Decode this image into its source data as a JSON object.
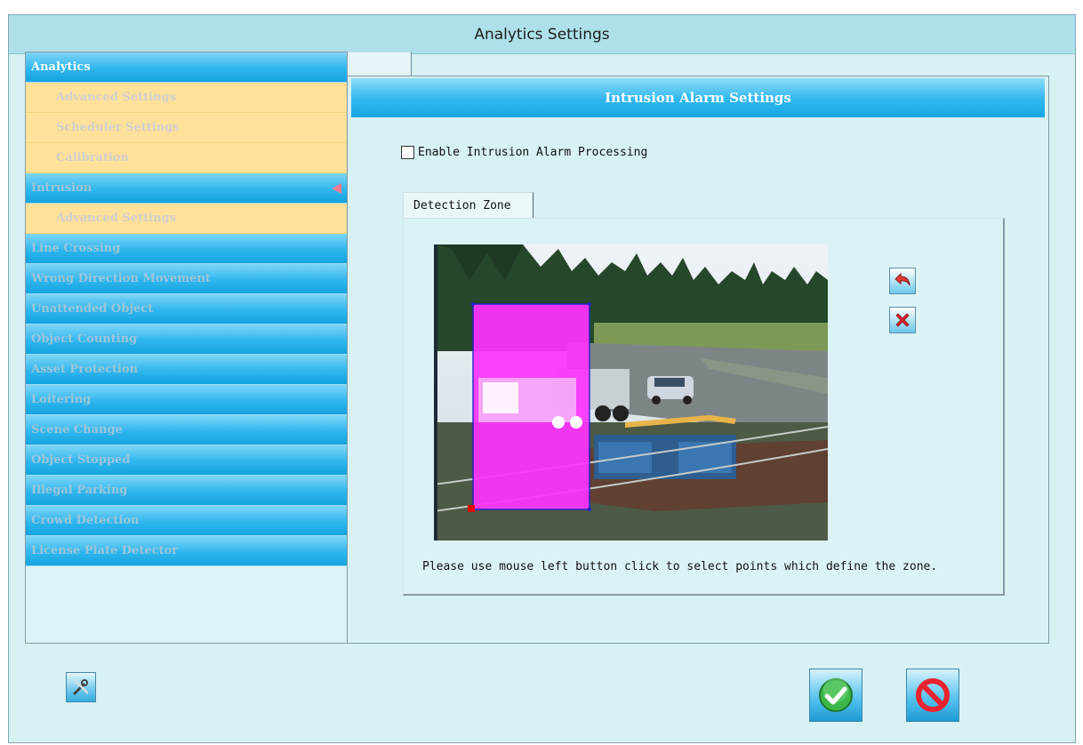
{
  "window": {
    "title": "Analytics Settings"
  },
  "sidebar": {
    "items": [
      {
        "label": "Analytics",
        "kind": "cat",
        "active": true
      },
      {
        "label": "Advanced Settings",
        "kind": "sub"
      },
      {
        "label": "Scheduler Settings",
        "kind": "sub"
      },
      {
        "label": "Calibration",
        "kind": "sub"
      },
      {
        "label": "Intrusion",
        "kind": "cat",
        "selected": true
      },
      {
        "label": "Advanced Settings",
        "kind": "sub"
      },
      {
        "label": "Line Crossing",
        "kind": "cat"
      },
      {
        "label": "Wrong Direction Movement",
        "kind": "cat"
      },
      {
        "label": "Unattended Object",
        "kind": "cat"
      },
      {
        "label": "Object Counting",
        "kind": "cat"
      },
      {
        "label": "Asset Protection",
        "kind": "cat"
      },
      {
        "label": "Loitering",
        "kind": "cat"
      },
      {
        "label": "Scene Change",
        "kind": "cat"
      },
      {
        "label": "Object Stopped",
        "kind": "cat"
      },
      {
        "label": "Illegal Parking",
        "kind": "cat"
      },
      {
        "label": "Crowd Detection",
        "kind": "cat"
      },
      {
        "label": "License Plate Detector",
        "kind": "cat"
      }
    ]
  },
  "main": {
    "header": "Intrusion Alarm Settings",
    "enable_label": "Enable Intrusion Alarm Processing",
    "enable_checked": false,
    "zone_tab": "Detection Zone",
    "hint": "Please use mouse left button click to select points which define the zone."
  },
  "icons": {
    "undo": "undo-arrow-icon",
    "delete": "delete-x-icon",
    "tools": "tools-icon",
    "ok": "checkmark-icon",
    "cancel": "no-entry-icon"
  },
  "colors": {
    "zone_fill": "#ff33ff",
    "header_blue": "#1fa9e4",
    "sub_item": "#ffe19a",
    "ok_green": "#3cb84a",
    "cancel_red": "#e8232e"
  }
}
